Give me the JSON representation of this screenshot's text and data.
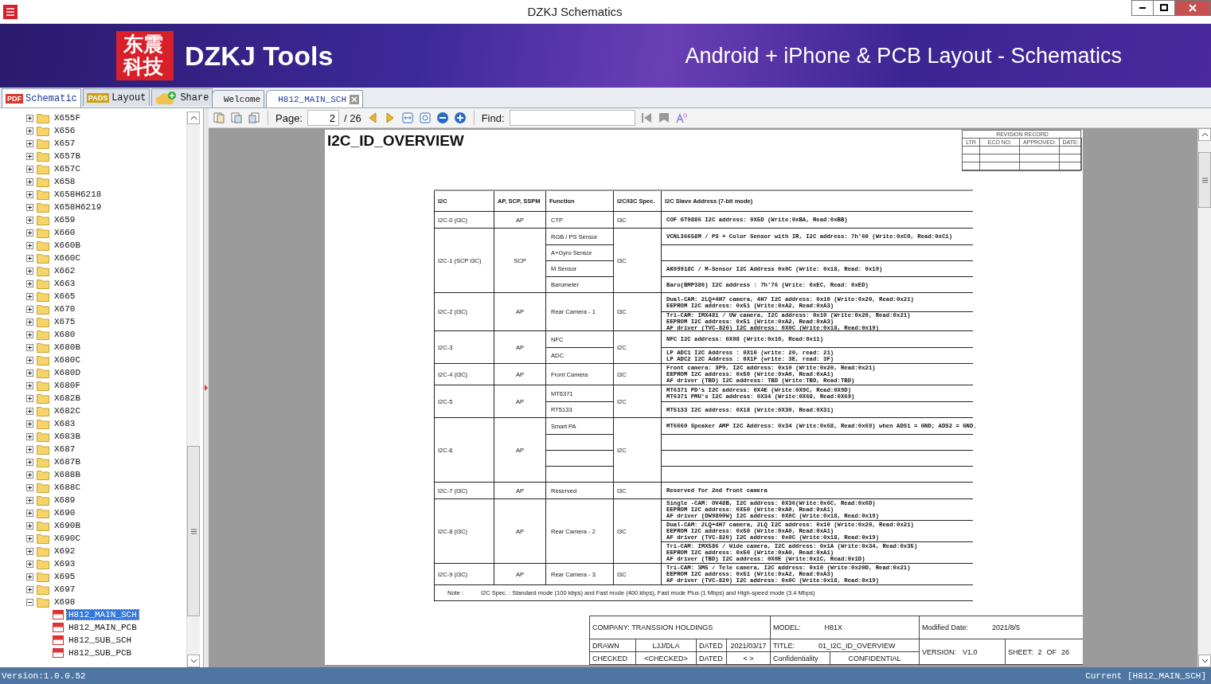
{
  "window": {
    "title": "DZKJ Schematics"
  },
  "banner": {
    "logo_text": "东震科技",
    "brand": "DZKJ Tools",
    "tagline": "Android + iPhone & PCB Layout - Schematics"
  },
  "side_tabs": [
    {
      "label": "Schematic",
      "badge": "PDF",
      "kind": "pdf",
      "selected": true
    },
    {
      "label": "Layout",
      "badge": "PADS",
      "kind": "pads",
      "selected": false
    },
    {
      "label": "Share",
      "kind": "cloud",
      "selected": false
    }
  ],
  "doc_tabs": [
    {
      "label": "Welcome",
      "selected": false,
      "closable": false
    },
    {
      "label": "H812_MAIN_SCH",
      "selected": true,
      "closable": true
    }
  ],
  "tree": [
    {
      "label": "X655F",
      "expanded": false
    },
    {
      "label": "X656",
      "expanded": false
    },
    {
      "label": "X657",
      "expanded": false
    },
    {
      "label": "X657B",
      "expanded": false
    },
    {
      "label": "X657C",
      "expanded": false
    },
    {
      "label": "X658",
      "expanded": false
    },
    {
      "label": "X658H6218",
      "expanded": false
    },
    {
      "label": "X658H6219",
      "expanded": false
    },
    {
      "label": "X659",
      "expanded": false
    },
    {
      "label": "X660",
      "expanded": false
    },
    {
      "label": "X660B",
      "expanded": false
    },
    {
      "label": "X660C",
      "expanded": false
    },
    {
      "label": "X662",
      "expanded": false
    },
    {
      "label": "X663",
      "expanded": false
    },
    {
      "label": "X665",
      "expanded": false
    },
    {
      "label": "X670",
      "expanded": false
    },
    {
      "label": "X675",
      "expanded": false
    },
    {
      "label": "X680",
      "expanded": false
    },
    {
      "label": "X680B",
      "expanded": false
    },
    {
      "label": "X680C",
      "expanded": false
    },
    {
      "label": "X680D",
      "expanded": false
    },
    {
      "label": "X680F",
      "expanded": false
    },
    {
      "label": "X682B",
      "expanded": false
    },
    {
      "label": "X682C",
      "expanded": false
    },
    {
      "label": "X683",
      "expanded": false
    },
    {
      "label": "X683B",
      "expanded": false
    },
    {
      "label": "X687",
      "expanded": false
    },
    {
      "label": "X687B",
      "expanded": false
    },
    {
      "label": "X688B",
      "expanded": false
    },
    {
      "label": "X688C",
      "expanded": false
    },
    {
      "label": "X689",
      "expanded": false
    },
    {
      "label": "X690",
      "expanded": false
    },
    {
      "label": "X690B",
      "expanded": false
    },
    {
      "label": "X690C",
      "expanded": false
    },
    {
      "label": "X692",
      "expanded": false
    },
    {
      "label": "X693",
      "expanded": false
    },
    {
      "label": "X695",
      "expanded": false
    },
    {
      "label": "X697",
      "expanded": false
    },
    {
      "label": "X698",
      "expanded": true,
      "children": [
        {
          "label": "H812_MAIN_SCH",
          "selected": true
        },
        {
          "label": "H812_MAIN_PCB",
          "selected": false
        },
        {
          "label": "H812_SUB_SCH",
          "selected": false
        },
        {
          "label": "H812_SUB_PCB",
          "selected": false
        }
      ]
    }
  ],
  "toolbar": {
    "page_label": "Page:",
    "page_value": "2",
    "page_total": "/ 26",
    "find_label": "Find:"
  },
  "document": {
    "title": "I2C_ID_OVERVIEW",
    "revision_record": {
      "title": "REVISION RECORD",
      "columns": [
        "LTR",
        "ECO NO:",
        "APPROVED:",
        "DATE:"
      ]
    },
    "table": {
      "columns": [
        "I2C",
        "AP, SCP, SSPM",
        "Function",
        "I2C/I3C Spec.",
        "I2C Slave Address (7-bit mode)"
      ],
      "groups": [
        {
          "bus": "I2C-0 (I3C)",
          "core": "AP",
          "spec": "I3C",
          "functions": [
            {
              "kind": "text",
              "text": "CTP"
            }
          ],
          "addresses": [
            {
              "kind": "text",
              "lines": [
                "COF GT9886 I2C address: 0X5D (Write:0xBA, Read:0xBB)"
              ]
            }
          ]
        },
        {
          "bus": "I2C-1 (SCP I3C)",
          "core": "SCP",
          "spec": "I3C",
          "functions": [
            {
              "kind": "text",
              "text": "RGB / PS Sensor"
            },
            {
              "kind": "text",
              "text": "A+Gyro Sensor"
            },
            {
              "kind": "text",
              "text": "M Sensor"
            },
            {
              "kind": "text",
              "text": "Barometer"
            }
          ],
          "addresses": [
            {
              "kind": "text",
              "lines": [
                "VCNL36658M / PS + Color Sensor with IR, I2C address: 7h'60 (Write:0xC0, Read:0xC1)"
              ]
            },
            {
              "kind": "blank"
            },
            {
              "kind": "text",
              "lines": [
                "AK09918C / M-Sensor I2C Address 0x0C (Write: 0x18, Read: 0x19)"
              ]
            },
            {
              "kind": "text",
              "lines": [
                "Baro(BMP380) I2C address : 7h'76 (Write: 0xEC, Read: 0xED)"
              ]
            }
          ]
        },
        {
          "bus": "I2C-2 (I3C)",
          "core": "AP",
          "spec": "I3C",
          "functions": [
            {
              "kind": "text",
              "text": "Rear Camera - 1"
            }
          ],
          "addresses": [
            {
              "kind": "text",
              "lines": [
                "Dual-CAM: 2LQ+4H7 camera, 4H7 I2C address: 0x10 (Write:0x20, Read:0x21)",
                "EEPROM I2C address: 0x51 (Write:0xA2, Read:0xA3)"
              ]
            },
            {
              "kind": "text",
              "lines": [
                "Tri-CAM: IMX481 / UW camera, I2C address: 0x10 (Write:0x20, Read:0x21)",
                "EEPROM I2C address: 0x51 (Write:0xA2, Read:0xA3)",
                "AF driver (TVC-820) I2C address: 0X0C (Write:0x18, Read:0x19)"
              ]
            }
          ]
        },
        {
          "bus": "I2C-3",
          "core": "AP",
          "spec": "I2C",
          "functions": [
            {
              "kind": "text",
              "text": "NFC"
            },
            {
              "kind": "text",
              "text": "ADC"
            }
          ],
          "addresses": [
            {
              "kind": "text",
              "lines": [
                "NFC I2C address: 0X08 (Write:0x10, Read:0x11)"
              ]
            },
            {
              "kind": "text",
              "lines": [
                "LP ADC1 I2C Address : 0X10 (write: 20, read: 21)",
                "LP ADC2 I2C Address : 0X1F (write: 3E, read: 3F)"
              ]
            }
          ]
        },
        {
          "bus": "I2C-4 (I3C)",
          "core": "AP",
          "spec": "I3C",
          "functions": [
            {
              "kind": "text",
              "text": "Front Camera"
            }
          ],
          "addresses": [
            {
              "kind": "text",
              "lines": [
                "Front camera: 3P9, I2C address: 0x10 (Write:0x20, Read:0x21)",
                "EEPROM I2C address: 0x50 (Write:0xA0, Read:0xA1)",
                "AF driver (TBD) I2C address: TBD (Write:TBD, Read:TBD)"
              ]
            }
          ]
        },
        {
          "bus": "I2C-5",
          "core": "AP",
          "spec": "I2C",
          "functions": [
            {
              "kind": "text",
              "text": "MT6371"
            },
            {
              "kind": "text",
              "text": "RT5133"
            }
          ],
          "addresses": [
            {
              "kind": "text",
              "lines": [
                "MT6371 PD's I2C address: 0X4E (Write:0X9C, Read:0X9D)",
                "MT6371 PMU's I2C address: 0X34 (Write:0X68, Read:0X69)"
              ]
            },
            {
              "kind": "text",
              "lines": [
                "MT5133 I2C address: 0X18 (Write:0X30, Read:0X31)"
              ]
            }
          ]
        },
        {
          "bus": "I2C-6",
          "core": "AP",
          "spec": "I2C",
          "functions": [
            {
              "kind": "text",
              "text": "Smart PA"
            },
            {
              "kind": "blank"
            },
            {
              "kind": "blank"
            },
            {
              "kind": "blank"
            }
          ],
          "addresses": [
            {
              "kind": "text",
              "lines": [
                "MT6660 Speaker AMP I2C Address: 0x34 (Write:0x68, Read:0x69) when ADS1 = GND; ADS2 = GND."
              ]
            },
            {
              "kind": "blank"
            },
            {
              "kind": "blank"
            },
            {
              "kind": "blank"
            }
          ]
        },
        {
          "bus": "I2C-7 (I3C)",
          "core": "AP",
          "spec": "I3C",
          "functions": [
            {
              "kind": "text",
              "text": "Reserved"
            }
          ],
          "addresses": [
            {
              "kind": "text",
              "lines": [
                "Reserved for 2nd front camera"
              ]
            }
          ]
        },
        {
          "bus": "I2C-8 (I3C)",
          "core": "AP",
          "spec": "I3C",
          "functions": [
            {
              "kind": "text",
              "text": "Rear Camera - 2"
            }
          ],
          "addresses": [
            {
              "kind": "text",
              "lines": [
                "Single -CAM: OV48B, I2C address: 0X36(Write:0x6C, Read:0x6D)",
                "EEPROM I2C address: 0X50 (Write:0xA0, Read:0xA1)",
                "AF driver (DW9800W) I2C address: 0X0C (Write:0x18, Read:0x19)"
              ]
            },
            {
              "kind": "text",
              "lines": [
                "Dual-CAM: 2LQ+4H7 camera, 2LQ I2C address: 0x10 (Write:0x20, Read:0x21)",
                "EEPROM I2C address: 0x50 (Write:0xA0, Read:0xA1)",
                "AF driver (TVC-820) I2C address: 0x0C (Write:0x18, Read:0x19)"
              ]
            },
            {
              "kind": "text",
              "lines": [
                "Tri-CAM: IMX586 / Wide camera, I2C address: 0x1A (Write:0x34, Read:0x35)",
                "EEPROM I2C address: 0x50 (Write:0xA0, Read:0xA1)",
                "AF driver (TBD) I2C address: 0X0E (Write:0x1C, Read:0x1D)"
              ]
            }
          ]
        },
        {
          "bus": "I2C-9 (I3C)",
          "core": "AP",
          "spec": "I3C",
          "functions": [
            {
              "kind": "text",
              "text": "Rear Camera - 3"
            }
          ],
          "addresses": [
            {
              "kind": "text",
              "lines": [
                "Tri-CAM: 3M5 / Tele camera, I2C address: 0x10 (Write:0x20D, Read:0x21)",
                "EEPROM I2C address: 0x51 (Write:0xA2, Read:0xA3)",
                "AF driver (TVC-820) I2C address: 0x0C (Write:0x18, Read:0x19)"
              ]
            }
          ]
        }
      ],
      "note_label": "Note :",
      "note": "I2C Spec. : Standard mode (100 kbps) and Fast mode (400 kbps), Fast mode Plus (1 Mbps) and High-speed mode (3.4 Mbps)"
    },
    "title_block": {
      "company": "COMPANY: TRANSSION HOLDINGS",
      "model_label": "MODEL:",
      "model": "H81X",
      "modified_label": "Modified Date:",
      "modified": "2021/8/5",
      "drawn_label": "DRAWN",
      "drawn": "LJJ/DLA",
      "dated_label": "DATED",
      "drawn_date": "2021/03/17",
      "title_label": "TITLE:",
      "title": "01_I2C_ID_OVERVIEW",
      "version_label": "VERSION:",
      "version": "V1.0",
      "sheet_label": "SHEET:",
      "sheet": "2",
      "of_label": "OF",
      "sheet_total": "26",
      "checked_label": "CHECKED",
      "checked": "<CHECKED>",
      "checked_dated_label": "DATED",
      "checked_date": "< >",
      "confidentiality_label": "Confidentiality",
      "confidentiality": "CONFIDENTIAL"
    }
  },
  "status_bar": {
    "version": "Version:1.0.0.52",
    "current": "Current [H812_MAIN_SCH]"
  }
}
